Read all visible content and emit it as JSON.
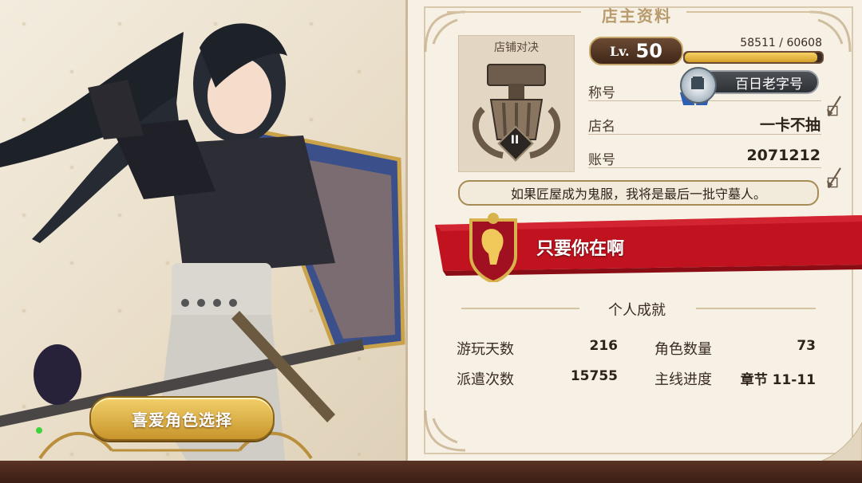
{
  "profile": {
    "section_title": "店主资料",
    "shop_duel_label": "店铺对决",
    "rank": "II",
    "level_label": "Lv.",
    "level": "50",
    "exp": "58511 / 60608",
    "exp_fraction": 0.9654,
    "title_label": "称号",
    "title_value": "百日老字号",
    "shop_label": "店名",
    "shop_value": "一卡不抽",
    "account_label": "账号",
    "account_value": "2071212",
    "motto": "如果匠屋成为鬼服，我将是最后一批守墓人。",
    "banner_text": "只要你在啊"
  },
  "achievements": {
    "title": "个人成就",
    "stats": [
      {
        "label": "游玩天数",
        "value": "216"
      },
      {
        "label": "角色数量",
        "value": "73"
      },
      {
        "label": "派遣次数",
        "value": "15755"
      },
      {
        "label": "主线进度",
        "value": "章节 11-11"
      }
    ]
  },
  "left": {
    "favorite_button": "喜爱角色选择"
  },
  "colors": {
    "banner_red": "#c0121f",
    "gold": "#d5a02a"
  }
}
